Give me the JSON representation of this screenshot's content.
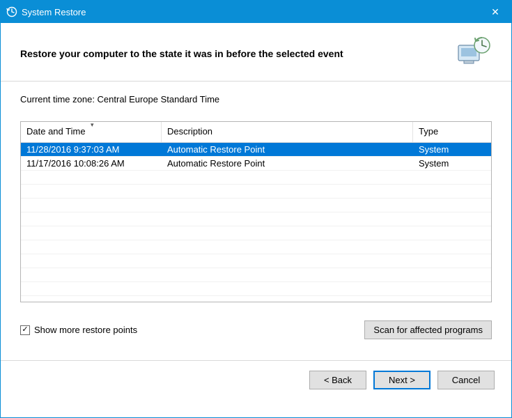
{
  "window": {
    "title": "System Restore",
    "close_glyph": "✕"
  },
  "heading": "Restore your computer to the state it was in before the selected event",
  "timezone_label": "Current time zone: Central Europe Standard Time",
  "columns": {
    "date": "Date and Time",
    "desc": "Description",
    "type": "Type"
  },
  "rows": [
    {
      "date": "11/28/2016 9:37:03 AM",
      "desc": "Automatic Restore Point",
      "type": "System",
      "selected": true
    },
    {
      "date": "11/17/2016 10:08:26 AM",
      "desc": "Automatic Restore Point",
      "type": "System",
      "selected": false
    }
  ],
  "show_more": {
    "checked": true,
    "label": "Show more restore points"
  },
  "scan_button": "Scan for affected programs",
  "buttons": {
    "back": "< Back",
    "next": "Next >",
    "cancel": "Cancel"
  }
}
